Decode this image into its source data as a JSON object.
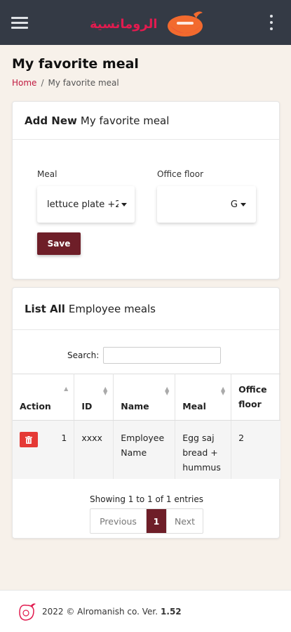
{
  "app": {
    "logo_text": "الرومانسية",
    "menu_icon": "hamburger-icon",
    "more_icon": "kebab-icon"
  },
  "page": {
    "title": "My favorite meal"
  },
  "breadcrumb": {
    "home": "Home",
    "separator": "/",
    "current": "My favorite meal"
  },
  "add_card": {
    "title_bold": "Add New",
    "title_rest": "My favorite meal",
    "meal_label": "Meal",
    "meal_value": "lettuce plate +2",
    "floor_label": "Office floor",
    "floor_value": "G",
    "save_label": "Save"
  },
  "list_card": {
    "title_bold": "List All",
    "title_rest": "Employee meals",
    "search_label": "Search:",
    "search_value": "",
    "columns": [
      "Action",
      "ID",
      "Name",
      "Meal",
      "Office floor"
    ],
    "rows": [
      {
        "id": "1",
        "code": "xxxx",
        "name": "Employee Name",
        "meal": "Egg saj bread + hummus",
        "floor": "2"
      }
    ],
    "showing": "Showing 1 to 1 of 1 entries",
    "pager": {
      "prev": "Previous",
      "current": "1",
      "next": "Next"
    }
  },
  "footer": {
    "text": "2022 © Alromanish co. Ver.",
    "version": "1.52"
  },
  "colors": {
    "topbar": "#343a45",
    "accent": "#6e1e28",
    "brand_red": "#e11b4f",
    "delete": "#e53935",
    "background": "#f7f1ea"
  }
}
